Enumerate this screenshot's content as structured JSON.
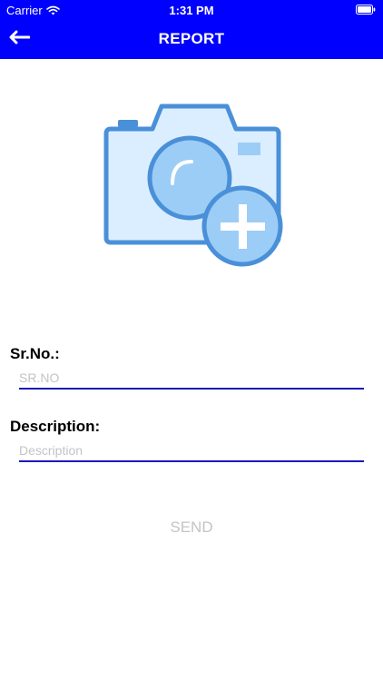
{
  "status_bar": {
    "carrier": "Carrier",
    "time": "1:31 PM",
    "wifi_icon": "wifi-icon",
    "battery_icon": "battery-icon"
  },
  "nav": {
    "title": "REPORT",
    "back_icon": "arrow-left-icon"
  },
  "photo": {
    "icon": "add-photo-camera-icon"
  },
  "form": {
    "srno_label": "Sr.No.:",
    "srno_placeholder": "SR.NO",
    "srno_value": "",
    "description_label": "Description:",
    "description_placeholder": "Description",
    "description_value": "",
    "send_label": "SEND"
  },
  "colors": {
    "header": "#0000ff",
    "input_underline": "#1a1ab8",
    "placeholder": "#c4c4c8",
    "camera_fill": "#dbeeff",
    "camera_stroke": "#4a90d9",
    "plus_fill": "#9ccdf6"
  }
}
